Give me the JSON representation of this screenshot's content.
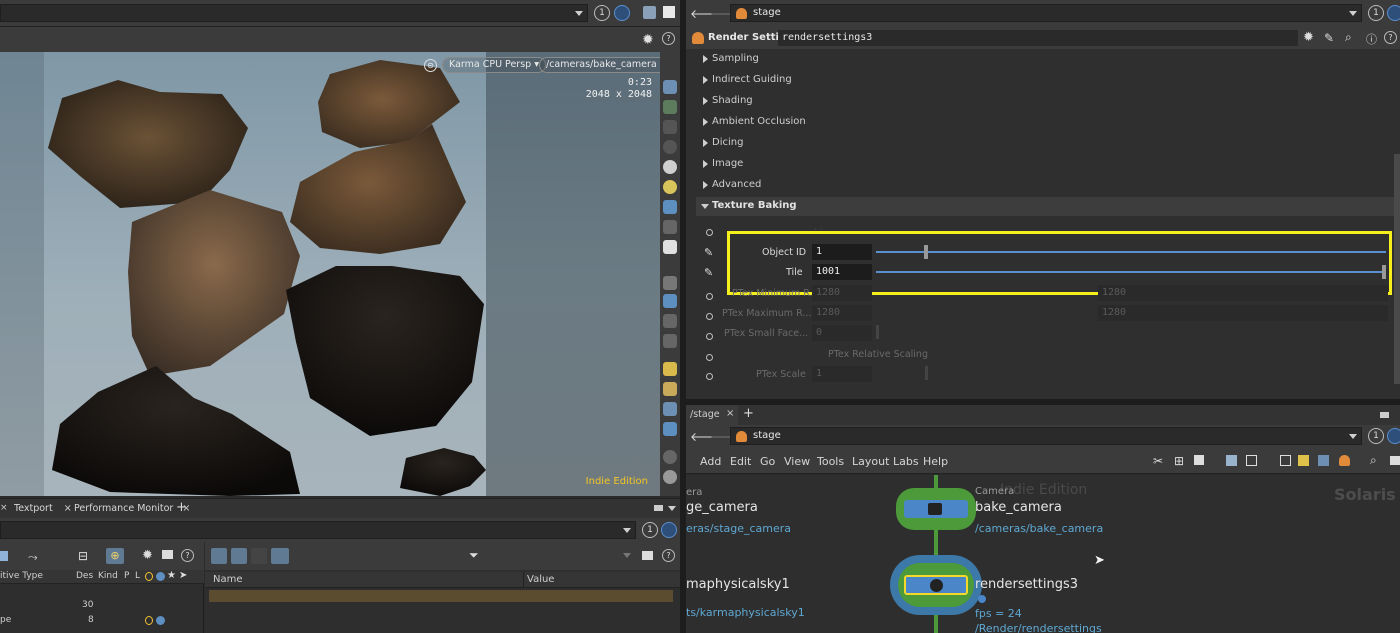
{
  "top_left_bar": {
    "counter": "1"
  },
  "viewport": {
    "renderer_pill": "Karma CPU Persp",
    "camera_pill": "/cameras/bake_camera",
    "time": "0:23",
    "resolution": "2048 x 2048",
    "edition": "Indie Edition"
  },
  "bottom_left_tabs": [
    "Textport",
    "Performance Monitor"
  ],
  "bottom_left_panel": {
    "counter": "1",
    "table_headers": [
      "itive Type",
      "Des",
      "Kind",
      "P",
      "L"
    ],
    "table_rows": [
      {
        "type": "",
        "des": "30"
      },
      {
        "type": "pe",
        "des": "8"
      }
    ],
    "props_headers": [
      "Name",
      "Value"
    ]
  },
  "params_panel": {
    "path": "stage",
    "node_type": "Render Settings",
    "node_name": "rendersettings3",
    "sections": [
      "Sampling",
      "Indirect Guiding",
      "Shading",
      "Ambient Occlusion",
      "Dicing",
      "Image",
      "Advanced"
    ],
    "open_section": "Texture Baking",
    "params": [
      {
        "label": "Object ID",
        "value": "1"
      },
      {
        "label": "Tile",
        "value": "1001"
      },
      {
        "label": "PTex Minimum R...",
        "value": "1280",
        "value2": "1280"
      },
      {
        "label": "PTex Maximum R...",
        "value": "1280",
        "value2": "1280"
      },
      {
        "label": "PTex Small Face...",
        "value": "0"
      },
      {
        "label": "PTex Relative Scaling",
        "value": ""
      },
      {
        "label": "PTex Scale",
        "value": "1"
      }
    ]
  },
  "network": {
    "tab": "/stage",
    "path": "stage",
    "counter": "1",
    "menu": [
      "Add",
      "Edit",
      "Go",
      "View",
      "Tools",
      "Layout",
      "Labs",
      "Help"
    ],
    "watermark": "Indie Edition",
    "context_label": "Solaris",
    "nodes": [
      {
        "type": "Camera",
        "name": "bake_camera",
        "path": "/cameras/bake_camera"
      },
      {
        "type": "",
        "name": "rendersettings3",
        "info": "fps = 24",
        "path": "/Render/rendersettings"
      }
    ],
    "left_nodes": [
      {
        "type": "era",
        "name": "ge_camera",
        "path": "eras/stage_camera"
      },
      {
        "name": "maphysicalsky1",
        "path": "ts/karmaphysicalsky1"
      }
    ]
  }
}
